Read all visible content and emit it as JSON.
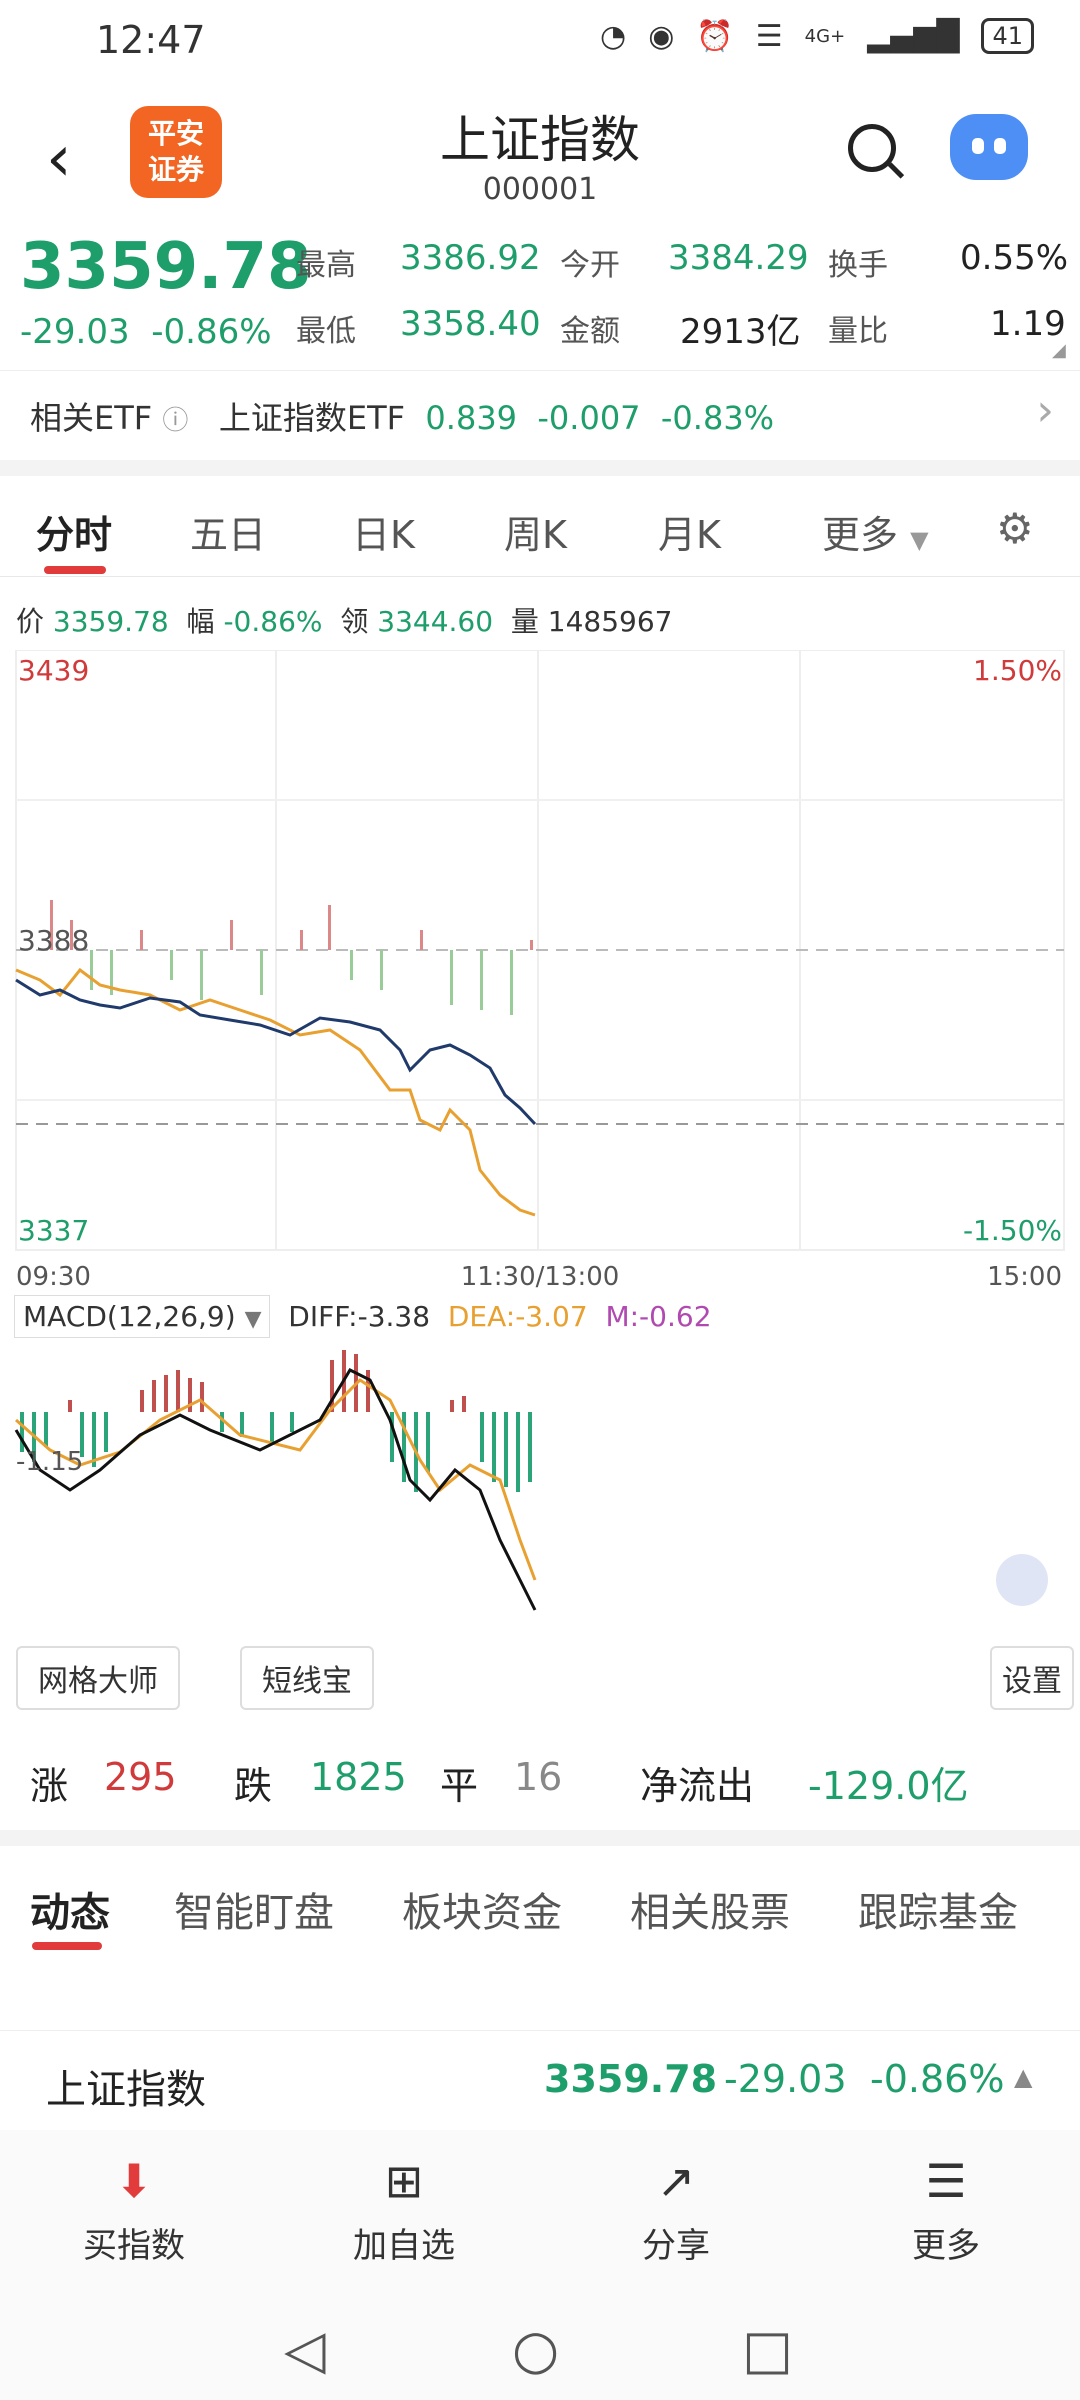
{
  "status": {
    "time": "12:47",
    "signal": "4G+",
    "battery": "41"
  },
  "header": {
    "title": "上证指数",
    "code": "000001",
    "logo": "平安\n证券"
  },
  "quote": {
    "price": "3359.78",
    "change": "-29.03",
    "change_pct": "-0.86%",
    "high_label": "最高",
    "high": "3386.92",
    "open_label": "今开",
    "open": "3384.29",
    "turnover_label": "换手",
    "turnover": "0.55%",
    "low_label": "最低",
    "low": "3358.40",
    "amount_label": "金额",
    "amount": "2913亿",
    "vol_ratio_label": "量比",
    "vol_ratio": "1.19"
  },
  "etf": {
    "label": "相关ETF",
    "name": "上证指数ETF",
    "price": "0.839",
    "change": "-0.007",
    "pct": "-0.83%"
  },
  "tabs": [
    "分时",
    "五日",
    "日K",
    "周K",
    "月K",
    "更多"
  ],
  "info_line": {
    "price_label": "价",
    "price": "3359.78",
    "pct_label": "幅",
    "pct": "-0.86%",
    "lead_label": "领",
    "lead": "3344.60",
    "vol_label": "量",
    "vol": "1485967"
  },
  "chart_labels": {
    "top_left": "3439",
    "top_right": "1.50%",
    "mid_left": "3388",
    "bottom_left": "3337",
    "bottom_right": "-1.50%",
    "t_start": "09:30",
    "t_mid": "11:30/13:00",
    "t_end": "15:00"
  },
  "macd": {
    "label": "MACD(12,26,9)",
    "diff": "DIFF:-3.38",
    "dea": "DEA:-3.07",
    "m": "M:-0.62",
    "axis": "-1.15"
  },
  "tools_left": {
    "b1": "网格大师",
    "b2": "短线宝",
    "b3": "设置"
  },
  "stats": {
    "up_label": "涨",
    "up": "295",
    "down_label": "跌",
    "down": "1825",
    "flat_label": "平",
    "flat": "16",
    "flow_label": "净流出",
    "flow": "-129.0亿"
  },
  "news_tabs": [
    "动态",
    "智能盯盘",
    "板块资金",
    "相关股票",
    "跟踪基金"
  ],
  "bottom_quote": {
    "name": "上证指数",
    "price": "3359.78",
    "change": "-29.03",
    "pct": "-0.86%"
  },
  "toolbar": {
    "buy": "买指数",
    "add": "加自选",
    "share": "分享",
    "more": "更多"
  },
  "colors": {
    "up": "#d03a3a",
    "down": "#1e9e6a",
    "accent": "#e23b3b",
    "line_price": "#1f3a6b",
    "line_avg": "#e8a030"
  }
}
